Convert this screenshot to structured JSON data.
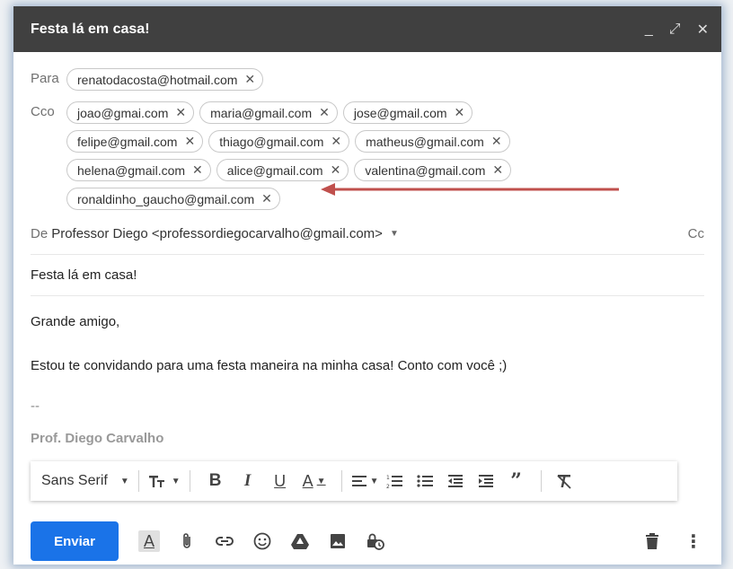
{
  "window": {
    "title": "Festa lá em casa!",
    "controls": {
      "minimize": "_",
      "fullscreen": "⤢",
      "close": "✕"
    }
  },
  "to": {
    "label": "Para",
    "recipients": [
      "renatodacosta@hotmail.com"
    ]
  },
  "bcc": {
    "label": "Cco",
    "recipients": [
      "joao@gmai.com",
      "maria@gmail.com",
      "jose@gmail.com",
      "felipe@gmail.com",
      "thiago@gmail.com",
      "matheus@gmail.com",
      "helena@gmail.com",
      "alice@gmail.com",
      "valentina@gmail.com",
      "ronaldinho_gaucho@gmail.com"
    ]
  },
  "from": {
    "label": "De",
    "value": "Professor Diego <professordiegocarvalho@gmail.com>",
    "cc_label": "Cc"
  },
  "subject": "Festa lá em casa!",
  "body": {
    "greeting": "Grande amigo,",
    "message": "Estou te convidando para uma festa maneira na minha casa! Conto com você ;)",
    "sig_sep": "--",
    "signature": "Prof. Diego Carvalho"
  },
  "format": {
    "font": "Sans Serif"
  },
  "send_label": "Enviar",
  "colors": {
    "accent": "#1a73e8",
    "titlebar": "#404040",
    "arrow": "#c0504d"
  }
}
